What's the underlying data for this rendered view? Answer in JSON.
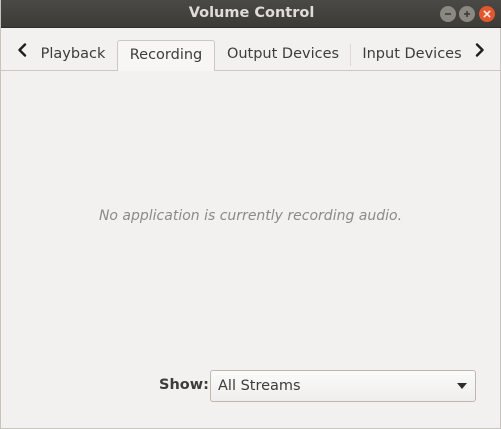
{
  "window": {
    "title": "Volume Control"
  },
  "window_controls": {
    "minimize_icon": "minimize-icon",
    "maximize_icon": "maximize-icon",
    "close_icon": "close-icon",
    "close_color": "#e4572e"
  },
  "tabs": [
    {
      "label": "Playback",
      "active": false
    },
    {
      "label": "Recording",
      "active": true
    },
    {
      "label": "Output Devices",
      "active": false
    },
    {
      "label": "Input Devices",
      "active": false
    }
  ],
  "nav": {
    "prev_icon": "chevron-left-icon",
    "next_icon": "chevron-right-icon"
  },
  "recording": {
    "empty_message": "No application is currently recording audio."
  },
  "filter": {
    "label": "Show:",
    "selected": "All Streams"
  }
}
